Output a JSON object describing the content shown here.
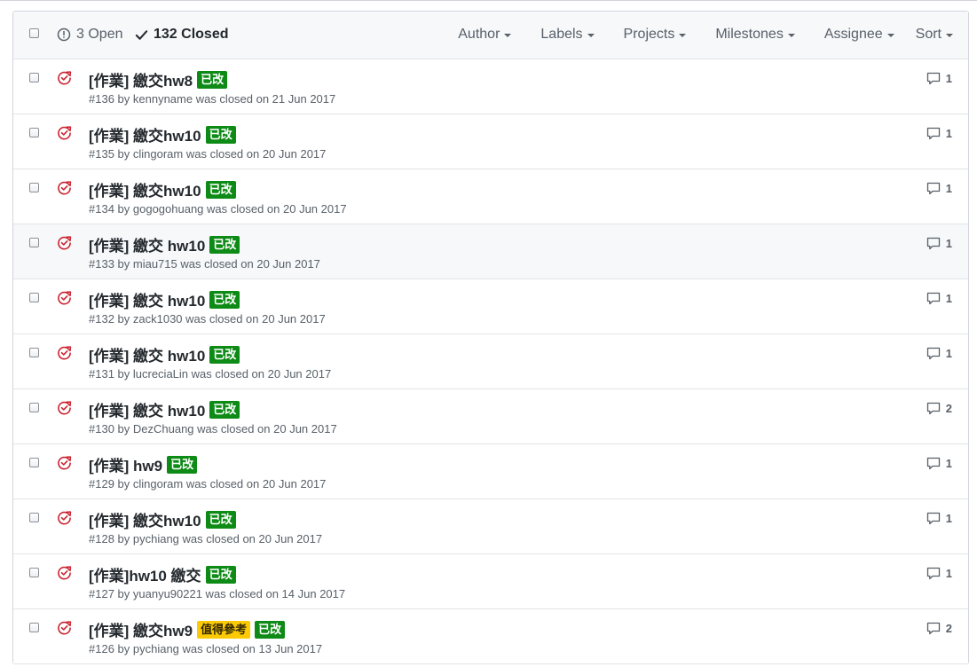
{
  "header": {
    "open_count": "3 Open",
    "closed_count": "132 Closed",
    "filters": [
      {
        "label": "Author"
      },
      {
        "label": "Labels"
      },
      {
        "label": "Projects"
      },
      {
        "label": "Milestones"
      },
      {
        "label": "Assignee"
      },
      {
        "label": "Sort"
      }
    ]
  },
  "issues": [
    {
      "title": "[作業] 繳交hw8",
      "labels": [
        "已改"
      ],
      "meta": "#136 by kennyname was closed on 21 Jun 2017",
      "comments": "1"
    },
    {
      "title": "[作業] 繳交hw10",
      "labels": [
        "已改"
      ],
      "meta": "#135 by clingoram was closed on 20 Jun 2017",
      "comments": "1"
    },
    {
      "title": "[作業] 繳交hw10",
      "labels": [
        "已改"
      ],
      "meta": "#134 by gogogohuang was closed on 20 Jun 2017",
      "comments": "1"
    },
    {
      "title": "[作業] 繳交 hw10",
      "labels": [
        "已改"
      ],
      "meta": "#133 by miau715 was closed on 20 Jun 2017",
      "comments": "1"
    },
    {
      "title": "[作業] 繳交 hw10",
      "labels": [
        "已改"
      ],
      "meta": "#132 by zack1030 was closed on 20 Jun 2017",
      "comments": "1"
    },
    {
      "title": "[作業] 繳交 hw10",
      "labels": [
        "已改"
      ],
      "meta": "#131 by lucreciaLin was closed on 20 Jun 2017",
      "comments": "1"
    },
    {
      "title": "[作業] 繳交 hw10",
      "labels": [
        "已改"
      ],
      "meta": "#130 by DezChuang was closed on 20 Jun 2017",
      "comments": "2"
    },
    {
      "title": "[作業] hw9",
      "labels": [
        "已改"
      ],
      "meta": "#129 by clingoram was closed on 20 Jun 2017",
      "comments": "1"
    },
    {
      "title": "[作業] 繳交hw10",
      "labels": [
        "已改"
      ],
      "meta": "#128 by pychiang was closed on 20 Jun 2017",
      "comments": "1"
    },
    {
      "title": "[作業]hw10 繳交",
      "labels": [
        "已改"
      ],
      "meta": "#127 by yuanyu90221 was closed on 14 Jun 2017",
      "comments": "1"
    },
    {
      "title": "[作業] 繳交hw9",
      "labels": [
        "值得參考",
        "已改"
      ],
      "meta": "#126 by pychiang was closed on 13 Jun 2017",
      "comments": "2"
    }
  ],
  "label_colors": {
    "已改": "#0e8a16",
    "值得參考": "#fbca04"
  },
  "icons": {
    "header_select": "checkbox",
    "open": "issue-opened-icon",
    "closed": "check-icon",
    "row_state": "issue-closed-icon",
    "comments": "comment-icon"
  }
}
